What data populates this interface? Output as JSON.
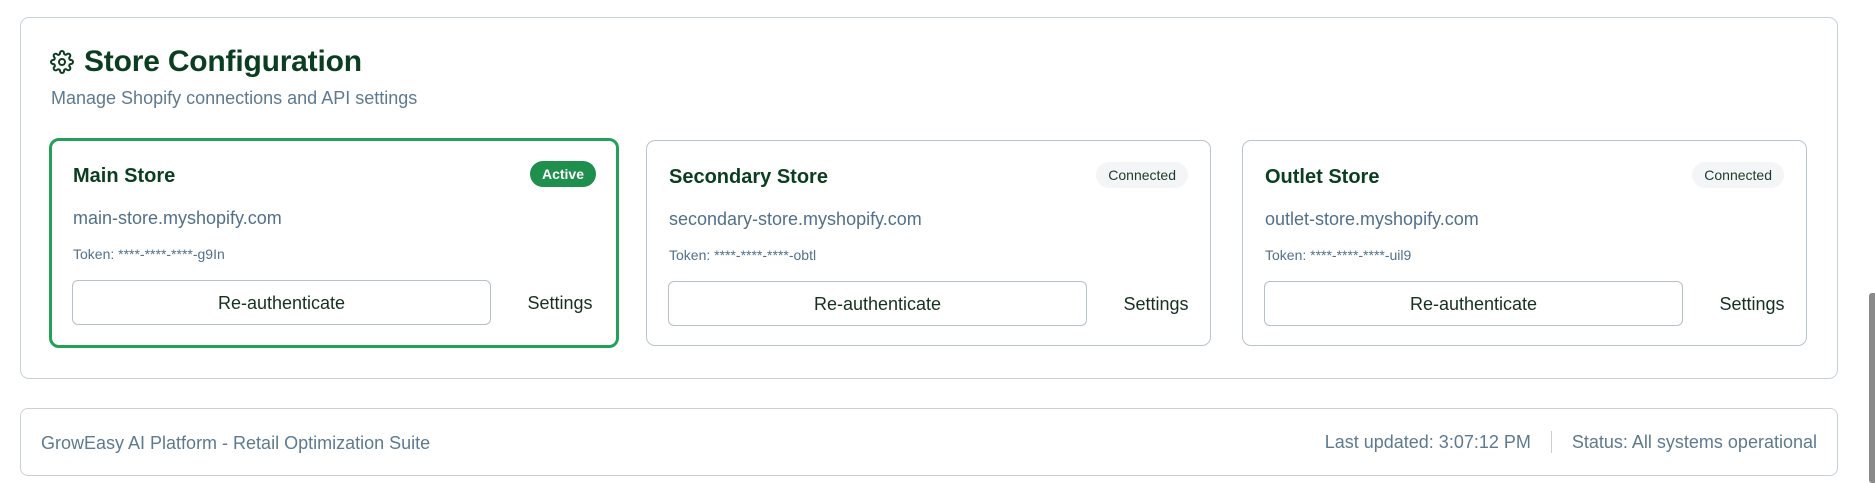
{
  "panel": {
    "icon": "gear-icon",
    "title": "Store Configuration",
    "subtitle": "Manage Shopify connections and API settings"
  },
  "stores": [
    {
      "name": "Main Store",
      "status": "Active",
      "domain": "main-store.myshopify.com",
      "token": "Token: ****-****-****-g9In",
      "reauth_label": "Re-authenticate",
      "settings_label": "Settings"
    },
    {
      "name": "Secondary Store",
      "status": "Connected",
      "domain": "secondary-store.myshopify.com",
      "token": "Token: ****-****-****-obtl",
      "reauth_label": "Re-authenticate",
      "settings_label": "Settings"
    },
    {
      "name": "Outlet Store",
      "status": "Connected",
      "domain": "outlet-store.myshopify.com",
      "token": "Token: ****-****-****-uil9",
      "reauth_label": "Re-authenticate",
      "settings_label": "Settings"
    }
  ],
  "footer": {
    "platform": "GrowEasy AI Platform - Retail Optimization Suite",
    "last_updated": "Last updated: 3:07:12 PM",
    "status": "Status: All systems operational"
  },
  "colors": {
    "primary_text": "#0b3d20",
    "muted_text": "#5e7a8f",
    "active_border": "#23a159",
    "active_badge": "#1f8f4d",
    "border": "#c9d1d8"
  }
}
